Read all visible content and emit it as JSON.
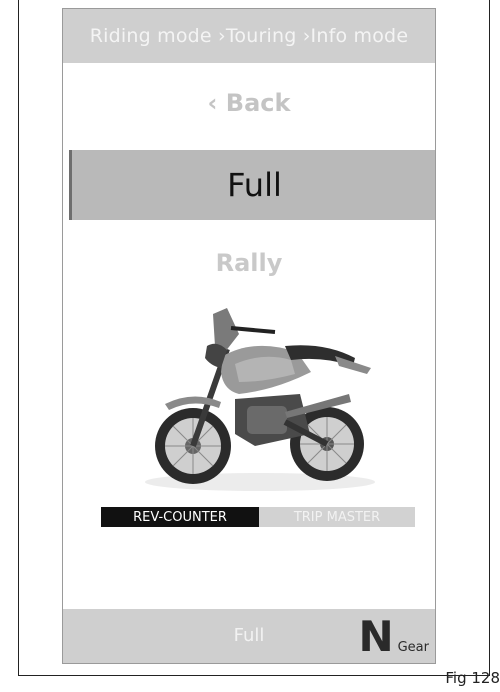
{
  "breadcrumb": {
    "text": "Riding mode ›Touring ›Info mode"
  },
  "menu": {
    "back_label": "‹ Back",
    "selected_label": "Full",
    "next_label": "Rally"
  },
  "tabs": [
    {
      "label": "REV-COUNTER",
      "active": true
    },
    {
      "label": "TRIP MASTER",
      "active": false
    }
  ],
  "status_bar": {
    "mode": "Full",
    "gear_value": "N",
    "gear_label": "Gear"
  },
  "figure_caption": "Fig 128",
  "colors": {
    "bar_bg": "#cfcfcf",
    "selected_bg": "#b9b9b9",
    "active_tab": "#111111"
  }
}
